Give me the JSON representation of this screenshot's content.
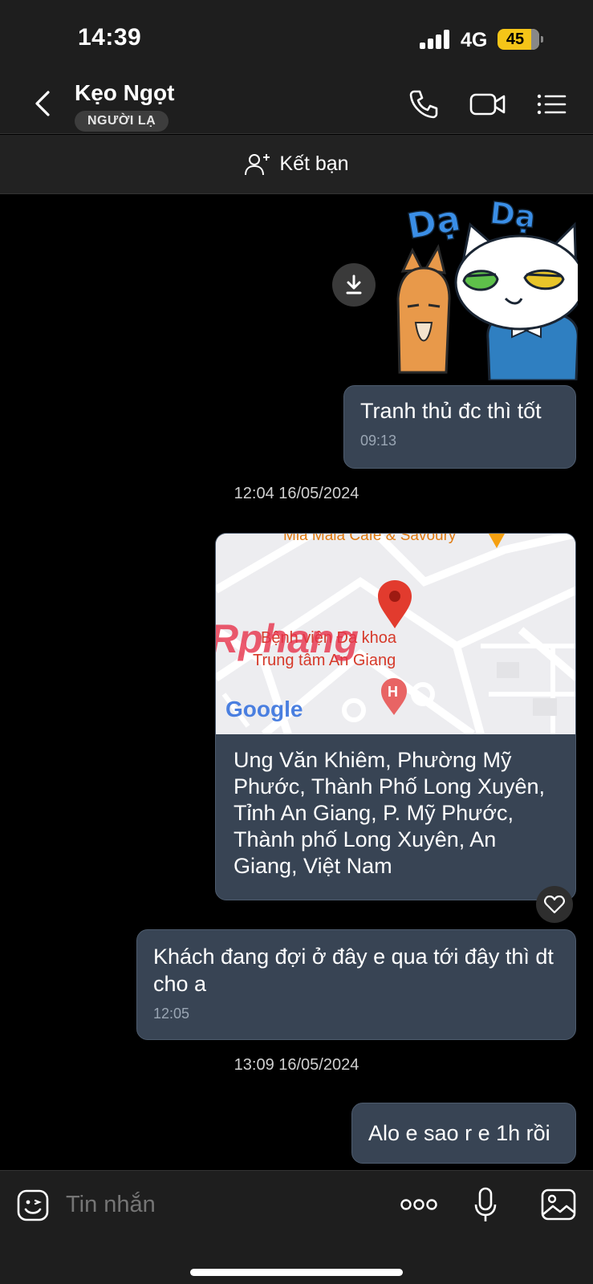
{
  "status_bar": {
    "time": "14:39",
    "network": "4G",
    "battery": "45"
  },
  "header": {
    "contact_name": "Kẹo Ngọt",
    "badge": "NGƯỜI LẠ",
    "icons": [
      "back-icon",
      "phone-icon",
      "video-call-icon",
      "menu-list-icon"
    ]
  },
  "friend_bar": {
    "label": "Kết bạn",
    "icon": "add-friend-icon"
  },
  "messages": [
    {
      "type": "sticker",
      "stickers_text": [
        "Dạ",
        "Dạ"
      ]
    },
    {
      "type": "text",
      "text": "Tranh thủ đc thì tốt",
      "time": "09:13"
    },
    {
      "type": "date",
      "text": "12:04 16/05/2024"
    },
    {
      "type": "location",
      "map_labels": {
        "place_top": "Mia Maia Cafe & Savoury",
        "hospital_line1": "Bệnh viện Đa khoa",
        "hospital_line2": "Trung tâm An Giang",
        "google": "Google",
        "watermark": "Rphang"
      },
      "address": "Ung Văn Khiêm, Phường Mỹ Phước, Thành Phố Long Xuyên, Tỉnh An Giang, P. Mỹ Phước, Thành phố Long Xuyên, An Giang, Việt Nam"
    },
    {
      "type": "text",
      "text": "Khách đang đợi ở đây e qua tới đây thì dt cho a",
      "time": "12:05"
    },
    {
      "type": "date",
      "text": "13:09 16/05/2024"
    },
    {
      "type": "text",
      "text": "Alo e sao r e 1h rồi"
    }
  ],
  "input_bar": {
    "placeholder": "Tin nhắn",
    "icons": [
      "sticker-icon",
      "more-icon",
      "microphone-icon",
      "image-icon"
    ]
  }
}
